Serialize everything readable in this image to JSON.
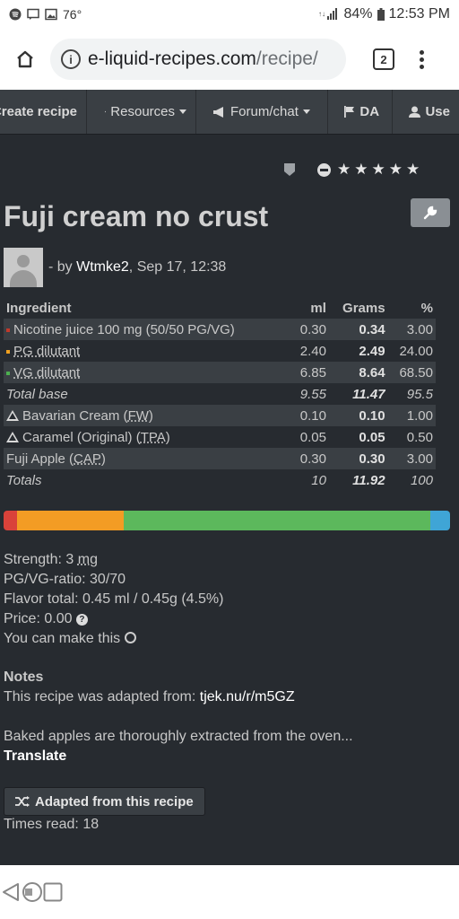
{
  "status_bar": {
    "temperature": "76°",
    "battery": "84%",
    "time": "12:53 PM"
  },
  "address_bar": {
    "domain": "e-liquid-recipes.com",
    "path": "/recipe/",
    "tab_count": "2"
  },
  "nav": {
    "items": [
      {
        "label": "Create recipe"
      },
      {
        "label": "Resources"
      },
      {
        "label": "Forum/chat"
      },
      {
        "label": "DA"
      },
      {
        "label": "Use"
      }
    ]
  },
  "recipe": {
    "title": "Fuji cream no crust",
    "author_prefix": "- by",
    "author": "Wtmke2",
    "date": ", Sep 17, 12:38",
    "rating_stars": 5
  },
  "table": {
    "headers": [
      "Ingredient",
      "ml",
      "Grams",
      "%"
    ],
    "rows": [
      {
        "name": "Nicotine juice 100 mg (50/50 PG/VG)",
        "ml": "0.30",
        "grams": "0.34",
        "pct": "3.00",
        "dot_color": "#c0392b"
      },
      {
        "name": "PG dilutant",
        "ml": "2.40",
        "grams": "2.49",
        "pct": "24.00",
        "dot_color": "#f0a020"
      },
      {
        "name": "VG dilutant",
        "ml": "6.85",
        "grams": "8.64",
        "pct": "68.50",
        "dot_color": "#4caf50"
      },
      {
        "name": "Total base",
        "ml": "9.55",
        "grams": "11.47",
        "pct": "95.5"
      },
      {
        "name": "Bavarian Cream",
        "vendor": "FW",
        "ml": "0.10",
        "grams": "0.10",
        "pct": "1.00"
      },
      {
        "name": "Caramel (Original)",
        "vendor": "TPA",
        "ml": "0.05",
        "grams": "0.05",
        "pct": "0.50"
      },
      {
        "name": "Fuji Apple",
        "vendor": "CAP",
        "ml": "0.30",
        "grams": "0.30",
        "pct": "3.00"
      },
      {
        "name": "Totals",
        "ml": "10",
        "grams": "11.92",
        "pct": "100"
      }
    ]
  },
  "composition_bar": {
    "segments": [
      {
        "label": "Nicotine",
        "pct": 3.0,
        "color": "#d9423a"
      },
      {
        "label": "PG",
        "pct": 24.0,
        "color": "#f39c24"
      },
      {
        "label": "VG",
        "pct": 68.5,
        "color": "#5cb85c"
      },
      {
        "label": "Flavor",
        "pct": 4.5,
        "color": "#3fa5d6"
      }
    ]
  },
  "stats": {
    "strength_label": "Strength: 3",
    "strength_unit": "mg",
    "pgvg": "PG/VG-ratio: 30/70",
    "flavor_total": "Flavor total: 0.45 ml / 0.45g (4.5%)",
    "price": "Price: 0.00",
    "make": "You can make this"
  },
  "notes": {
    "heading": "Notes",
    "adapted_text": "This recipe was adapted from:",
    "adapted_link": "tjek.nu/r/m5GZ",
    "body": "Baked apples are thoroughly extracted from the oven...",
    "translate": "Translate"
  },
  "actions": {
    "adapted_button": "Adapted from this recipe",
    "times_read": "Times read: 18"
  }
}
